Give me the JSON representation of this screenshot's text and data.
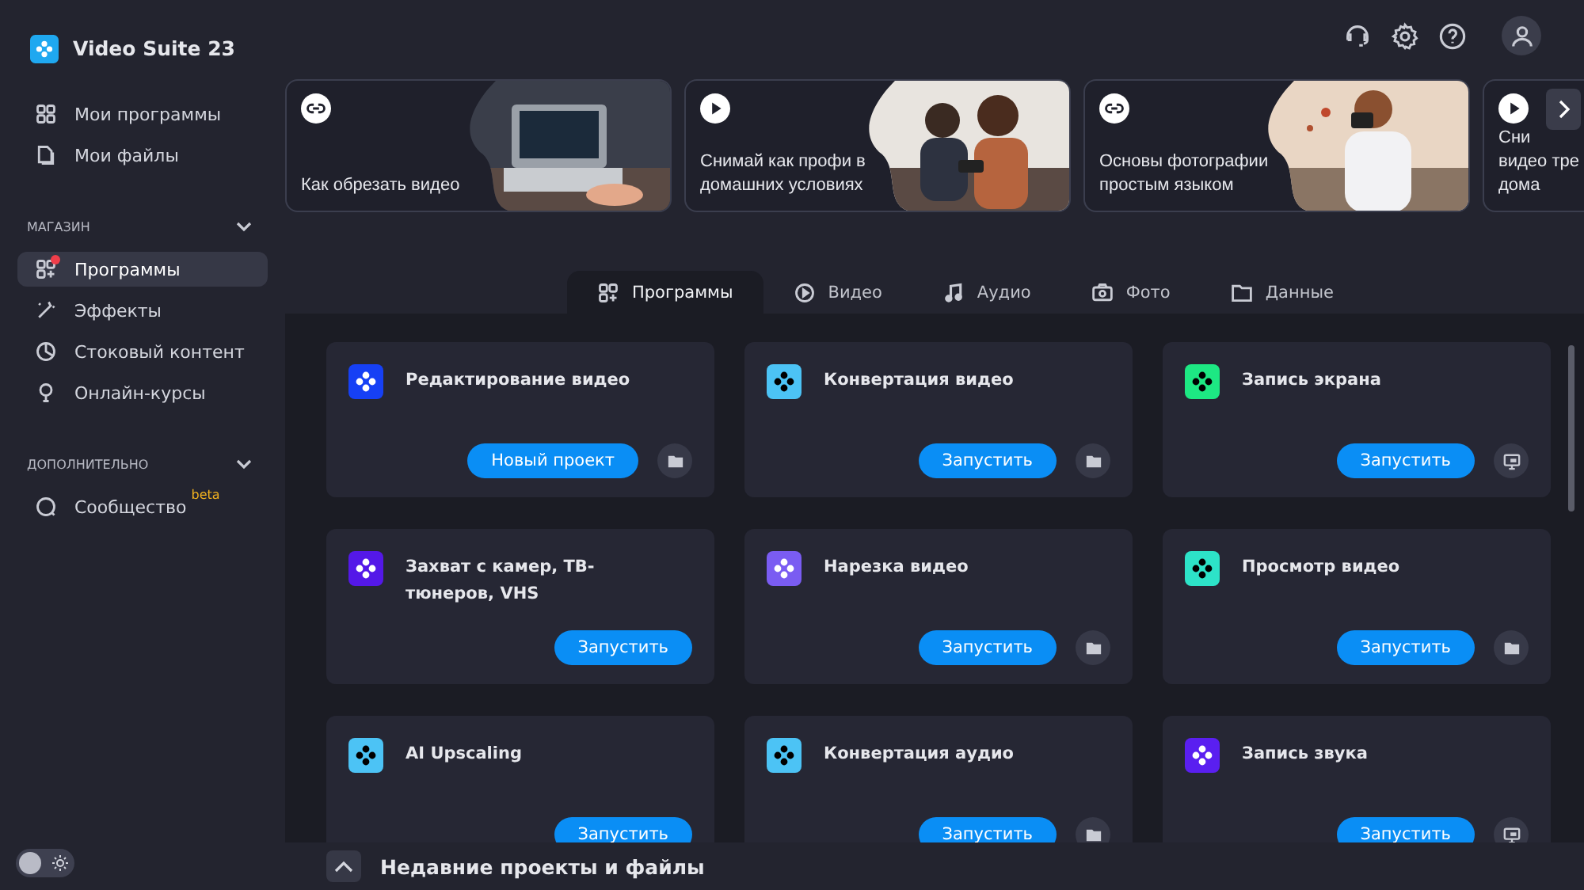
{
  "app": {
    "title": "Video Suite 23"
  },
  "sidebar": {
    "items": [
      {
        "label": "Мои программы",
        "selected": false,
        "badge": false
      },
      {
        "label": "Мои файлы",
        "selected": false,
        "badge": false
      }
    ],
    "sections": [
      {
        "title": "МАГАЗИН",
        "expanded": true,
        "items": [
          {
            "label": "Программы",
            "selected": true,
            "badge": true
          },
          {
            "label": "Эффекты",
            "selected": false,
            "badge": false
          },
          {
            "label": "Стоковый контент",
            "selected": false,
            "badge": false
          },
          {
            "label": "Онлайн-курсы",
            "selected": false,
            "badge": false
          }
        ]
      },
      {
        "title": "ДОПОЛНИТЕЛЬНО",
        "expanded": true,
        "items": [
          {
            "label": "Сообщество",
            "selected": false,
            "badge": false,
            "tag": "beta"
          }
        ]
      }
    ]
  },
  "theme_switch": {
    "on": false
  },
  "banners": [
    {
      "kind": "link",
      "lines": [
        "Как обрезать видео"
      ]
    },
    {
      "kind": "video",
      "lines": [
        "Снимай как профи в",
        "домашних условиях"
      ]
    },
    {
      "kind": "link",
      "lines": [
        "Основы фотографии",
        "простым языком"
      ]
    },
    {
      "kind": "video",
      "lines": [
        "Сни",
        "видео тре",
        "дома"
      ]
    }
  ],
  "tabs": [
    {
      "label": "Программы",
      "selected": true
    },
    {
      "label": "Видео",
      "selected": false
    },
    {
      "label": "Аудио",
      "selected": false
    },
    {
      "label": "Фото",
      "selected": false
    },
    {
      "label": "Данные",
      "selected": false
    }
  ],
  "apps": [
    {
      "title": "Редактирование видео",
      "color": "#1640f5",
      "button": "Новый проект",
      "kind": "folder"
    },
    {
      "title": "Конвертация видео",
      "color": "#4cc3f5",
      "button": "Запустить",
      "kind": "folder"
    },
    {
      "title": "Запись экрана",
      "color": "#1de883",
      "button": "Запустить",
      "kind": "monitor"
    },
    {
      "title": "Захват с камер, ТВ-тюнеров, VHS",
      "color": "#5418e8",
      "button": "Запустить",
      "kind": "plain"
    },
    {
      "title": "Нарезка видео",
      "color": "#7a5cf2",
      "button": "Запустить",
      "kind": "folder"
    },
    {
      "title": "Просмотр видео",
      "color": "#2de3c8",
      "button": "Запустить",
      "kind": "folder"
    },
    {
      "title": "AI Upscaling",
      "color": "#4cc3f5",
      "button": "Запустить",
      "kind": "plain"
    },
    {
      "title": "Конвертация аудио",
      "color": "#4cc3f5",
      "button": "Запустить",
      "kind": "folder"
    },
    {
      "title": "Запись звука",
      "color": "#5a1ff0",
      "button": "Запустить",
      "kind": "monitor"
    }
  ],
  "recent": {
    "title": "Недавние проекты и файлы"
  }
}
